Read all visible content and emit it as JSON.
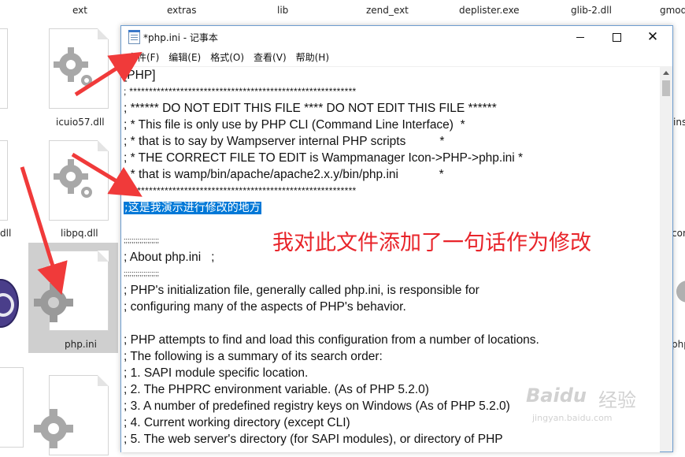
{
  "desktop": {
    "top_files": [
      "ext",
      "extras",
      "lib",
      "zend_ext",
      "deplister.exe",
      "glib-2.dll",
      "gmod"
    ],
    "left_files": [
      {
        "label": "icuio57.dll"
      },
      {
        "label": "libpq.dll"
      },
      {
        "label": "php.ini",
        "selected": true
      }
    ],
    "edge_labels": {
      "dll": "dll",
      "ins": "ins",
      "con": "con",
      "php": "php"
    }
  },
  "window": {
    "title": "*php.ini - 记事本",
    "controls": {
      "minimize": "minimize-icon",
      "maximize": "maximize-icon",
      "close": "close-icon"
    }
  },
  "menu": [
    "文件(F)",
    "编辑(E)",
    "格式(O)",
    "查看(V)",
    "帮助(H)"
  ],
  "editor": {
    "lines": [
      "[PHP]",
      "; **********************************************************",
      "; ****** DO NOT EDIT THIS FILE **** DO NOT EDIT THIS FILE ******",
      "; * This file is only use by PHP CLI (Command Line Interface)  *",
      "; * that is to say by Wampserver internal PHP scripts          *",
      "; * THE CORRECT FILE TO EDIT is Wampmanager Icon->PHP->php.ini *",
      "; * that is wamp/bin/apache/apache2.x.y/bin/php.ini            *",
      "; **********************************************************",
      ";这是我演示进行修改的地方",
      "",
      ";;;;;;;;;;;;;;;;;;",
      "; About php.ini   ;",
      ";;;;;;;;;;;;;;;;;;",
      "; PHP's initialization file, generally called php.ini, is responsible for",
      "; configuring many of the aspects of PHP's behavior.",
      "",
      "; PHP attempts to find and load this configuration from a number of locations.",
      "; The following is a summary of its search order:",
      "; 1. SAPI module specific location.",
      "; 2. The PHPRC environment variable. (As of PHP 5.2.0)",
      "; 3. A number of predefined registry keys on Windows (As of PHP 5.2.0)",
      "; 4. Current working directory (except CLI)",
      "; 5. The web server's directory (for SAPI modules), or directory of PHP"
    ],
    "highlighted_line_index": 8
  },
  "annotation": {
    "text": "我对此文件添加了一句话作为修改",
    "color": "#e8242a"
  },
  "watermark": {
    "logo": "Baidu",
    "brand": "经验",
    "url": "jingyan.baidu.com"
  },
  "colors": {
    "selection": "#0078d7",
    "arrow": "#f03a3a",
    "window_border": "#6e9dcf"
  }
}
